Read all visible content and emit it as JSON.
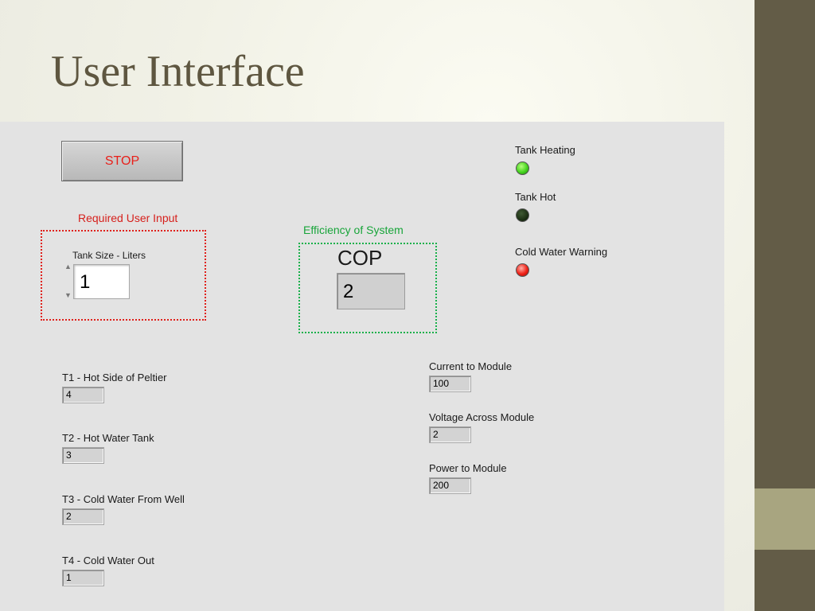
{
  "slide": {
    "title": "User Interface"
  },
  "stop_button": {
    "label": "STOP",
    "color": "#e8201a"
  },
  "user_input": {
    "heading": "Required User Input",
    "tank_size_label": "Tank Size - Liters",
    "tank_size_value": "1"
  },
  "efficiency": {
    "heading": "Efficiency of System",
    "cop_label": "COP",
    "cop_value": "2"
  },
  "temperatures": [
    {
      "label": "T1 - Hot Side of Peltier",
      "value": "4"
    },
    {
      "label": "T2 - Hot Water Tank",
      "value": "3"
    },
    {
      "label": "T3 - Cold Water From Well",
      "value": "2"
    },
    {
      "label": "T4 - Cold Water Out",
      "value": "1"
    }
  ],
  "module": [
    {
      "label": "Current to Module",
      "value": "100"
    },
    {
      "label": "Voltage Across Module",
      "value": "2"
    },
    {
      "label": "Power to Module",
      "value": "200"
    }
  ],
  "indicators": [
    {
      "label": "Tank Heating",
      "state": "on",
      "color": "#45d41f"
    },
    {
      "label": "Tank Hot",
      "state": "off",
      "color": "#1a2d12"
    },
    {
      "label": "Cold Water Warning",
      "state": "on",
      "color": "#ef2016"
    }
  ]
}
